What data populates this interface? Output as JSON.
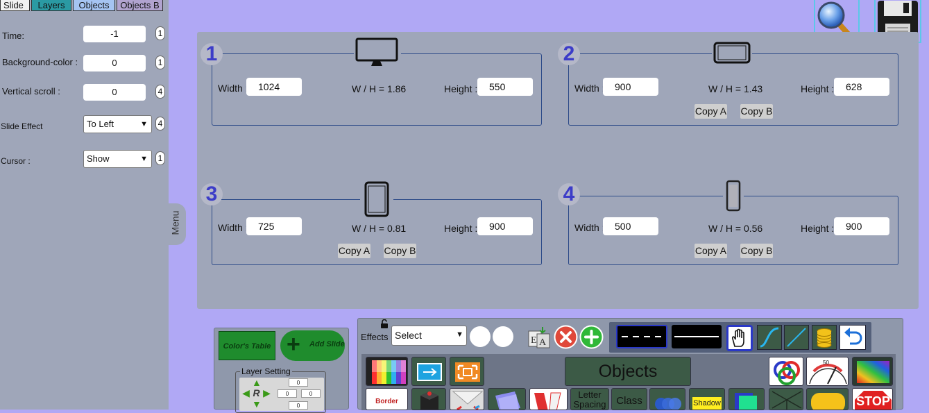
{
  "tabs": [
    "Slide",
    "Layers",
    "Objects",
    "Objects B"
  ],
  "slide_settings": {
    "time_label": "Time:",
    "time_value": "-1",
    "time_badge": "1",
    "bg_label": "Background-color :",
    "bg_value": "0",
    "bg_badge": "1",
    "vscroll_label": "Vertical scroll :",
    "vscroll_value": "0",
    "vscroll_badge": "4",
    "effect_label": "Slide Effect",
    "effect_value": "To Left",
    "effect_badge": "4",
    "cursor_label": "Cursor :",
    "cursor_value": "Show",
    "cursor_badge": "1"
  },
  "menu_label": "Menu",
  "devices": [
    {
      "num": "1",
      "width_label": "Width :",
      "width": "1024",
      "ratio": "W / H = 1.86",
      "height_label": "Height :",
      "height": "550",
      "icon": "monitor-icon"
    },
    {
      "num": "2",
      "width_label": "Width :",
      "width": "900",
      "ratio": "W / H = 1.43",
      "height_label": "Height :",
      "height": "628",
      "copy_a": "Copy A",
      "copy_b": "Copy B",
      "icon": "tablet-landscape-icon"
    },
    {
      "num": "3",
      "width_label": "Width :",
      "width": "725",
      "ratio": "W / H = 0.81",
      "height_label": "Height :",
      "height": "900",
      "copy_a": "Copy A",
      "copy_b": "Copy B",
      "icon": "tablet-portrait-icon"
    },
    {
      "num": "4",
      "width_label": "Width :",
      "width": "500",
      "ratio": "W / H = 0.56",
      "height_label": "Height :",
      "height": "900",
      "copy_a": "Copy A",
      "copy_b": "Copy B",
      "icon": "phone-icon"
    }
  ],
  "bottom_left": {
    "colors_table": "Color's Table",
    "add_slide": "Add Slide",
    "layer_setting": "Layer Setting",
    "layer_values": [
      "0",
      "0",
      "0",
      "0"
    ],
    "layer_letter": "R"
  },
  "toolbar": {
    "effects_label": "Effects",
    "effects_select": "Select",
    "objects_label": "Objects",
    "letter_spacing": "Letter Spacing",
    "class_label": "Class",
    "shadow_label": "Shadow",
    "border_label": "Border",
    "stop_label": "STOP",
    "gauge_value": "50"
  },
  "colors": {
    "background": "#b0a8f5",
    "panel": "#9fa6b9",
    "accent_blue": "#3c3cc8",
    "green_button": "#1f8c2d"
  }
}
